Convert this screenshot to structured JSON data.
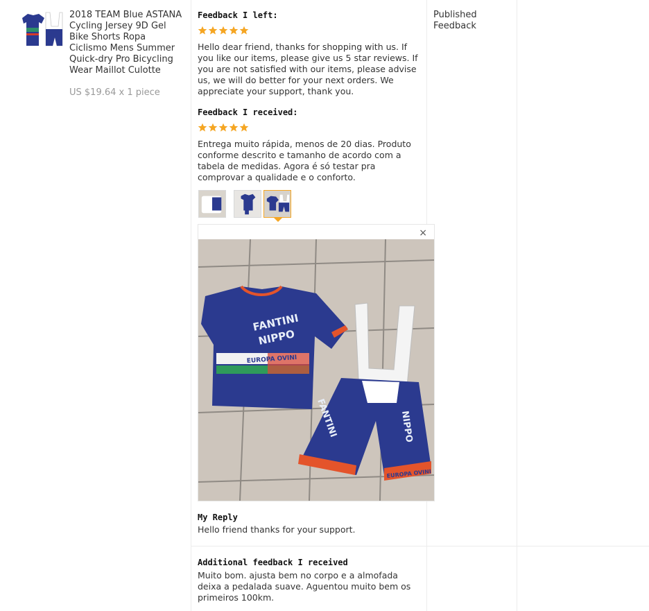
{
  "product": {
    "title": "2018 TEAM Blue ASTANA Cycling Jersey 9D Gel Bike Shorts Ropa Ciclismo Mens Summer Quick-dry Pro Bicycling Wear Maillot Culotte",
    "price": "US $19.64 x 1 piece"
  },
  "feedback_left": {
    "heading": "Feedback I left:",
    "rating": 5,
    "text": "Hello dear friend, thanks for shopping with us. If you like our items, please give us 5 star reviews. If you are not satisfied with our items, please advise us, we will do better for your next orders. We appreciate your support, thank you."
  },
  "feedback_received": {
    "heading": "Feedback I received:",
    "rating": 5,
    "text": "Entrega muito rápida, menos de 20 dias. Produto conforme descrito e tamanho de acordo com a tabela de medidas. Agora é só testar pra comprovar a qualidade e o conforto."
  },
  "image_viewer": {
    "close_glyph": "×",
    "photo_labels": {
      "jersey_brand": "FANTINI",
      "jersey_brand2": "NIPPO",
      "jersey_sponsor": "EUROPA OVINI",
      "shorts_brand": "FANTINI",
      "shorts_brand2": "NIPPO",
      "shorts_sponsor": "EUROPA OVINI"
    }
  },
  "my_reply": {
    "heading": "My Reply",
    "text": "Hello friend thanks for your support."
  },
  "additional_feedback": {
    "heading": "Additional feedback I received",
    "text": "Muito bom. ajusta bem no corpo e a almofada deixa a pedalada suave. Aguentou muito bem os primeiros 100km."
  },
  "status": {
    "text": "Published Feedback"
  },
  "colors": {
    "star": "#f5a623",
    "jersey_blue": "#2b3a8f",
    "accent_orange": "#f5a623"
  }
}
